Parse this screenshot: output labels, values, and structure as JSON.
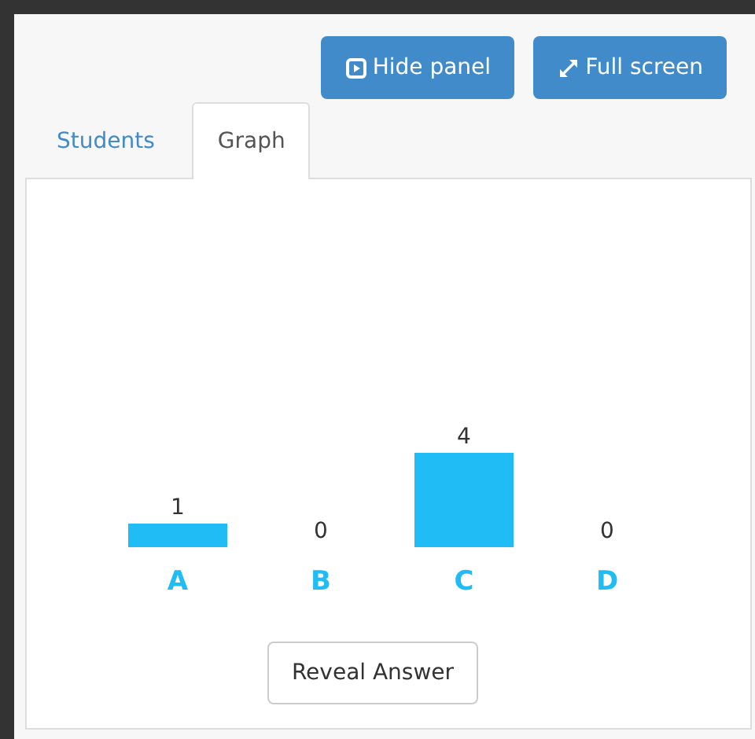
{
  "toolbar": {
    "buttons": [
      {
        "kind": "hide",
        "label": "Hide panel"
      },
      {
        "kind": "fullscreen",
        "label": "Full screen"
      }
    ]
  },
  "tabs": [
    {
      "label": "Students",
      "selected": false
    },
    {
      "label": "Graph",
      "selected": true
    }
  ],
  "graph": {
    "chart_data": {
      "type": "bar",
      "categories": [
        "A",
        "B",
        "C",
        "D"
      ],
      "values": [
        1,
        0,
        4,
        0
      ],
      "data_labels": true,
      "color": "#1fbcf5"
    },
    "button": "Reveal Answer"
  }
}
